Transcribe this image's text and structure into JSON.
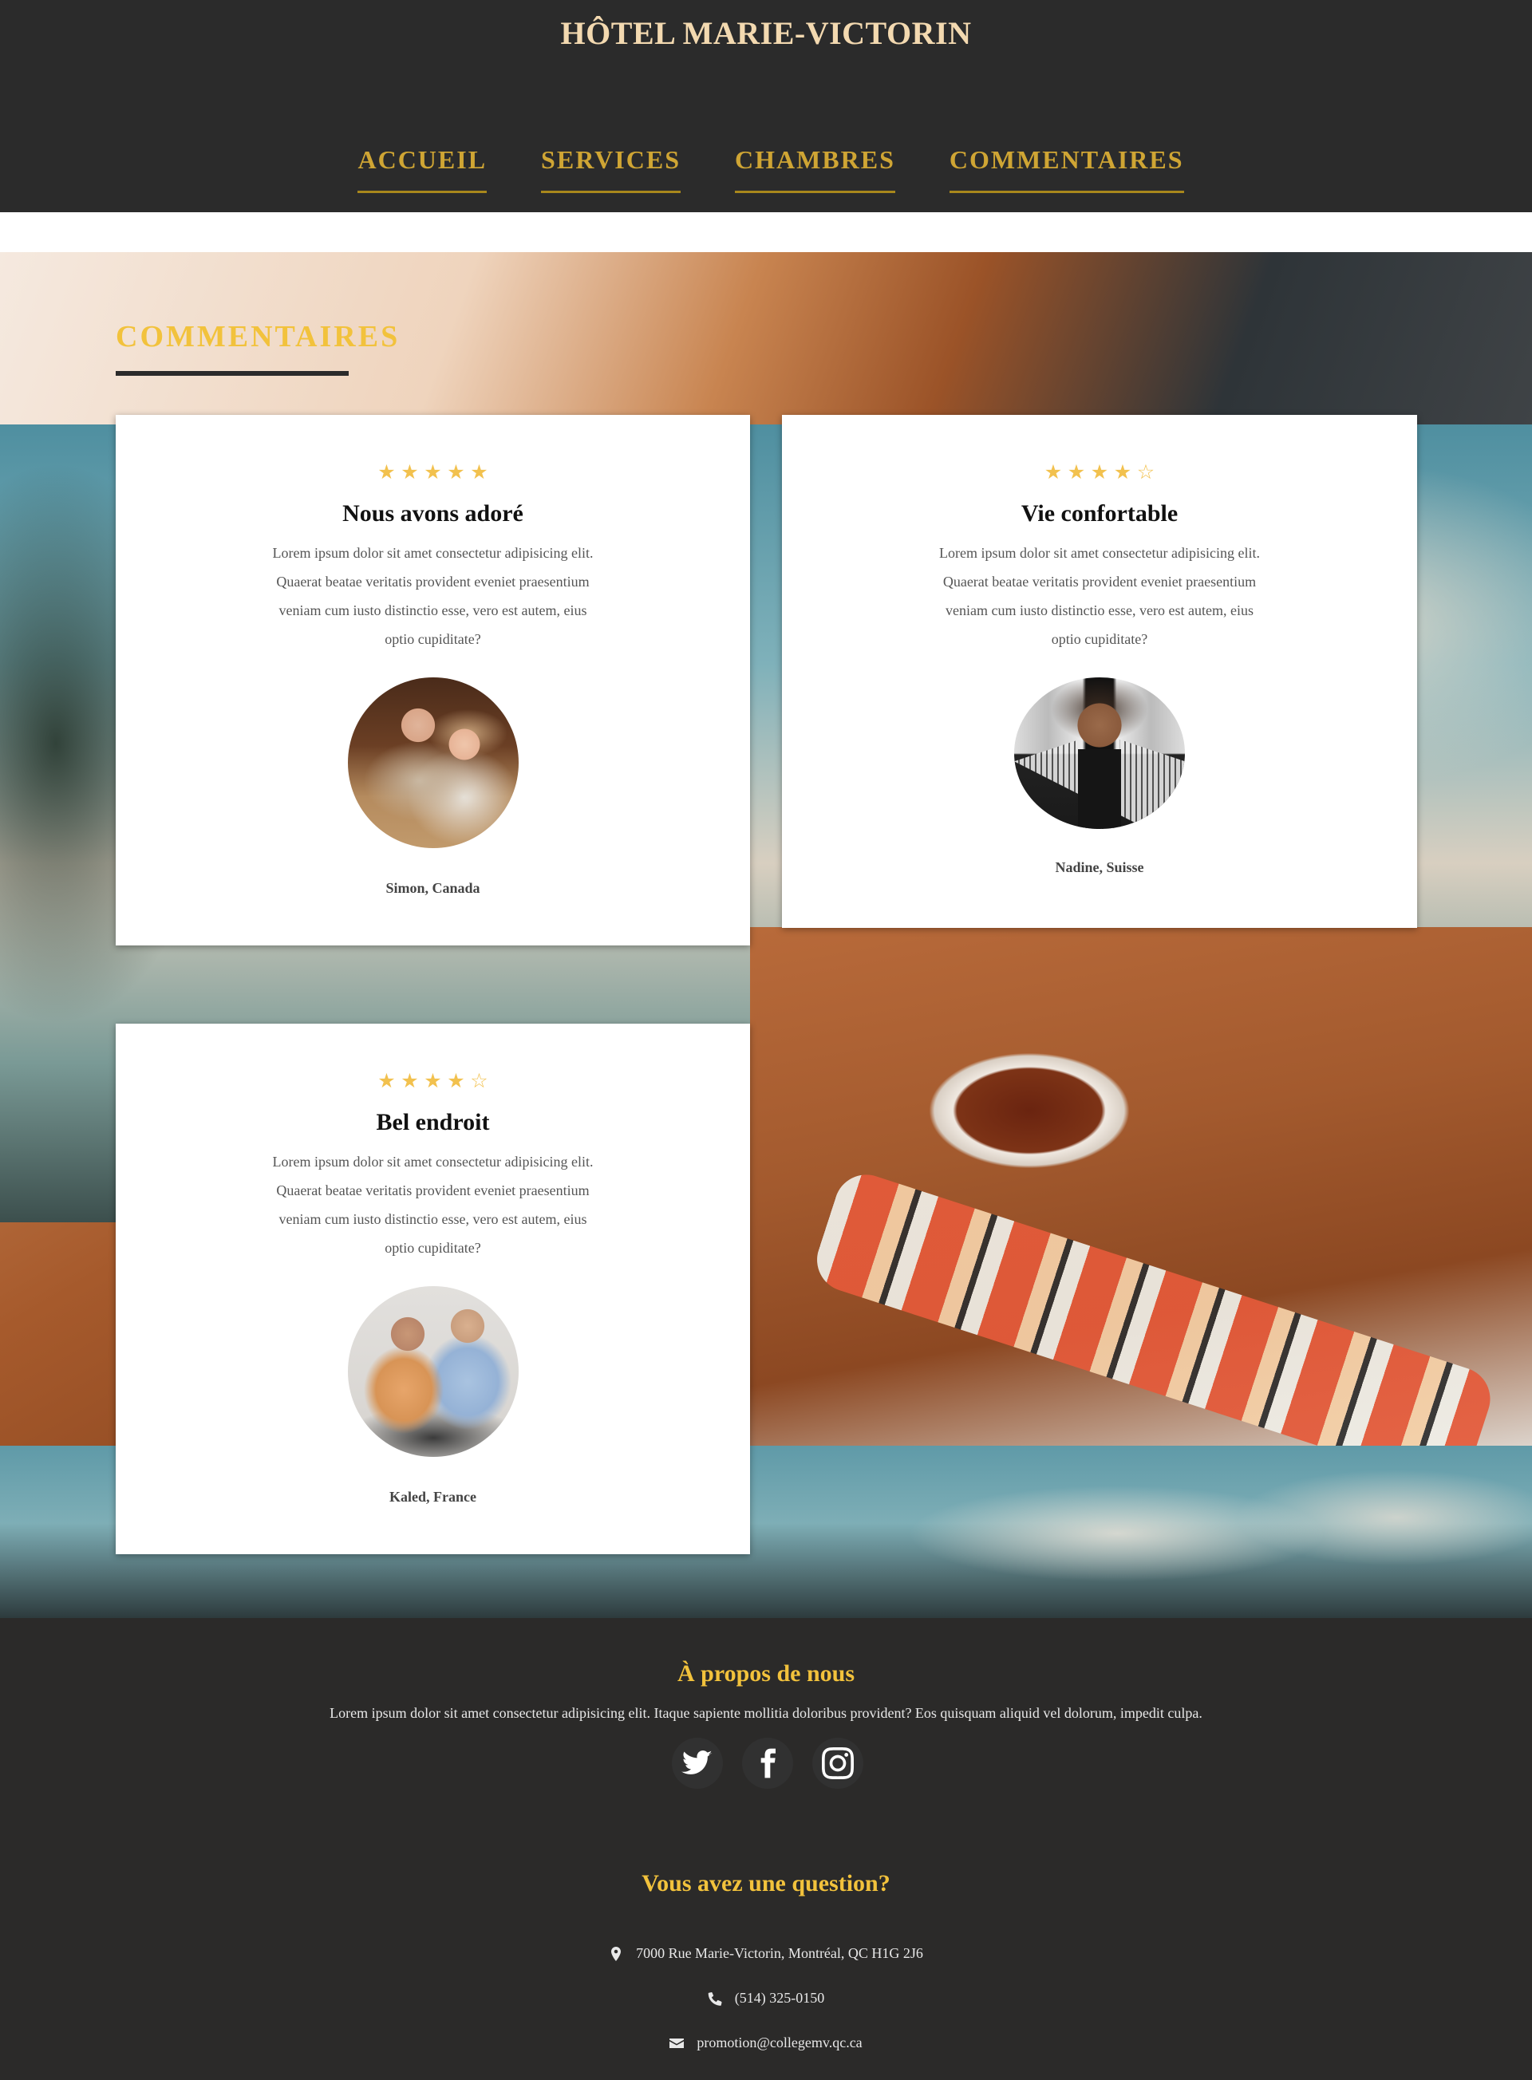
{
  "header": {
    "title": "HÔTEL MARIE-VICTORIN",
    "nav": [
      {
        "label": "ACCUEIL"
      },
      {
        "label": "SERVICES"
      },
      {
        "label": "CHAMBRES"
      },
      {
        "label": "COMMENTAIRES"
      }
    ]
  },
  "section": {
    "title": "COMMENTAIRES"
  },
  "reviews": [
    {
      "rating": 5,
      "title": "Nous avons adoré",
      "text": "Lorem ipsum dolor sit amet consectetur adipisicing elit. Quaerat beatae veritatis provident eveniet praesentium veniam cum iusto distinctio esse, vero est autem, eius optio cupiditate?",
      "author": "Simon, Canada"
    },
    {
      "rating": 4,
      "title": "Vie confortable",
      "text": "Lorem ipsum dolor sit amet consectetur adipisicing elit. Quaerat beatae veritatis provident eveniet praesentium veniam cum iusto distinctio esse, vero est autem, eius optio cupiditate?",
      "author": "Nadine, Suisse"
    },
    {
      "rating": 4,
      "title": "Bel endroit",
      "text": "Lorem ipsum dolor sit amet consectetur adipisicing elit. Quaerat beatae veritatis provident eveniet praesentium veniam cum iusto distinctio esse, vero est autem, eius optio cupiditate?",
      "author": "Kaled, France"
    }
  ],
  "footer": {
    "about_title": "À propos de nous",
    "about_text": "Lorem ipsum dolor sit amet consectetur adipisicing elit. Itaque sapiente mollitia doloribus provident? Eos quisquam aliquid vel dolorum, impedit culpa.",
    "socials": [
      "twitter-icon",
      "facebook-icon",
      "instagram-icon"
    ],
    "question_title": "Vous avez une question?",
    "address": "7000 Rue Marie-Victorin, Montréal, QC H1G 2J6",
    "phone": "(514) 325-0150",
    "email": "promotion@collegemv.qc.ca"
  },
  "colors": {
    "header_bg": "#2b2b2b",
    "accent_gold": "#cfa534",
    "accent_yellow": "#f2c23c",
    "star": "#f2c14e"
  }
}
